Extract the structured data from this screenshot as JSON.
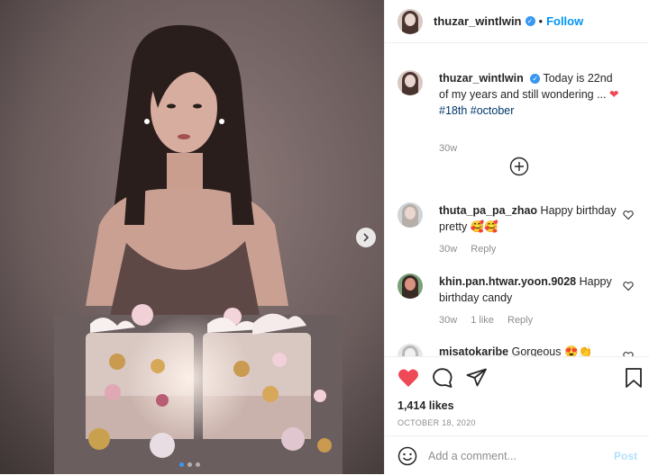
{
  "header": {
    "username": "thuzar_wintlwin",
    "separator": "•",
    "follow_label": "Follow"
  },
  "caption": {
    "username": "thuzar_wintlwin",
    "text": "Today is 22nd of my years and still wondering ...",
    "hashtags": "#18th #october",
    "time": "30w"
  },
  "comments": [
    {
      "username": "thuta_pa_pa_zhao",
      "text": "Happy birthday pretty 🥰🥰",
      "time": "30w",
      "likes": "",
      "reply_label": "Reply"
    },
    {
      "username": "khin.pan.htwar.yoon.9028",
      "text": "Happy birthday candy",
      "time": "30w",
      "likes": "1 like",
      "reply_label": "Reply"
    },
    {
      "username": "misatokaribe",
      "text": "Gorgeous 😍👏",
      "time": "",
      "likes": "",
      "reply_label": ""
    }
  ],
  "post_meta": {
    "likes": "1,414 likes",
    "date": "OCTOBER 18, 2020"
  },
  "add_comment": {
    "placeholder": "Add a comment...",
    "post_label": "Post"
  },
  "carousel": {
    "dots": 3,
    "active_index": 0
  },
  "colors": {
    "accent": "#0095f6",
    "heart": "#ed4956",
    "verified": "#3897f0"
  },
  "icons": [
    "verified-badge-icon",
    "heart-icon",
    "comment-icon",
    "share-icon",
    "bookmark-icon",
    "emoji-icon",
    "plus-circle-icon",
    "chevron-right-icon"
  ]
}
